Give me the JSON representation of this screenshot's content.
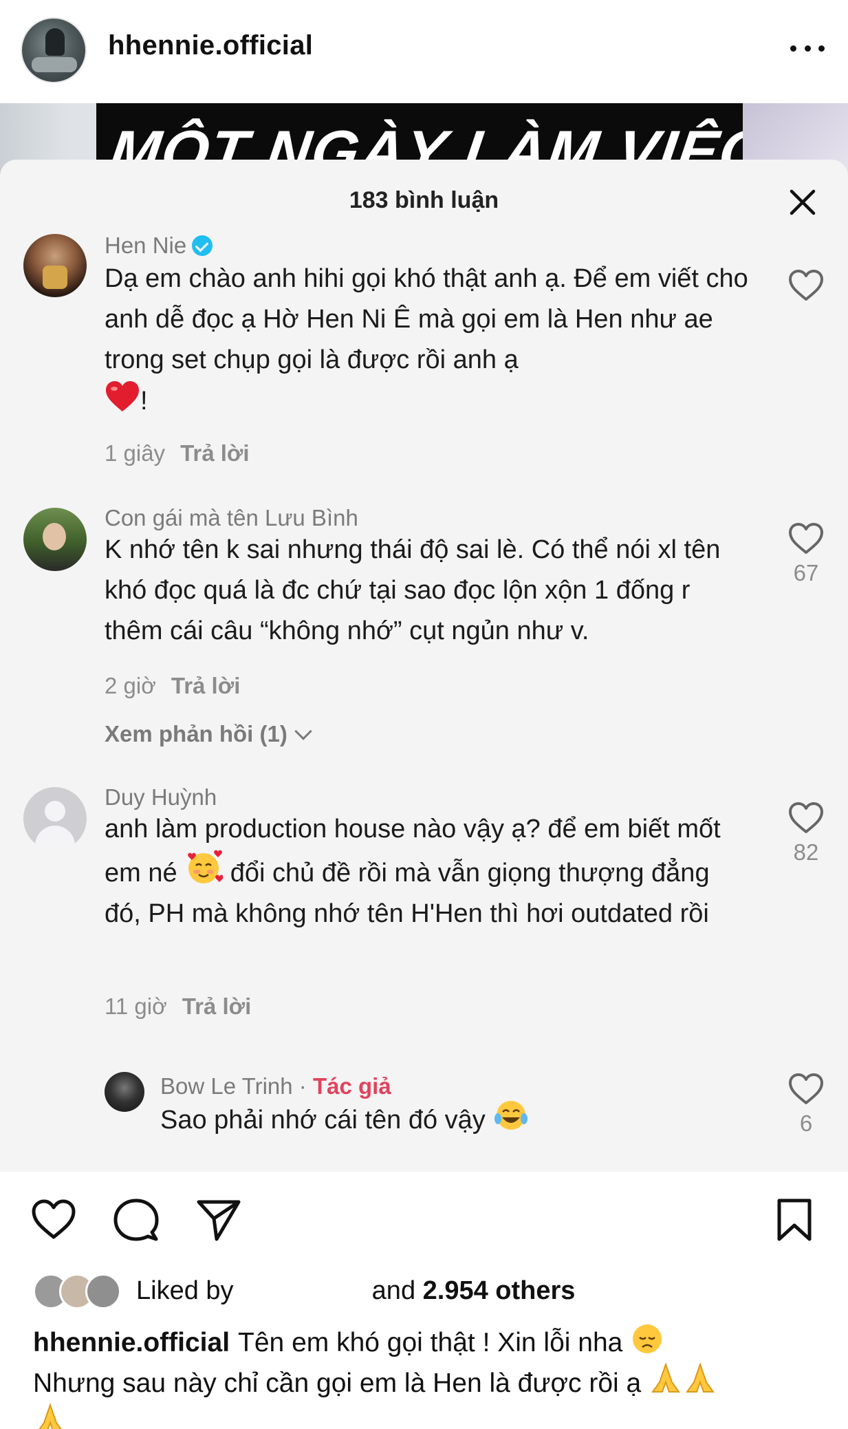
{
  "post": {
    "username": "hhennie.official"
  },
  "video": {
    "headline": "MỘT NGÀY LÀM VIỆC CỦA"
  },
  "sheet": {
    "title": "183 bình luận"
  },
  "comments": [
    {
      "author": "Hen Nie",
      "verified": true,
      "text": "Dạ em chào anh hihi gọi khó thật anh ạ. Để em viết cho anh dễ đọc ạ Hờ Hen Ni Ê mà gọi em là Hen như ae trong set chụp gọi là được rồi anh ạ",
      "text_end": "!",
      "time": "1 giây",
      "reply_label": "Trả lời",
      "likes": ""
    },
    {
      "author": "Con gái mà tên Lưu Bình",
      "text": "K nhớ tên k sai nhưng thái độ sai lè. Có thể nói xl tên khó đọc quá là đc chứ tại sao đọc lộn xộn 1 đống r thêm cái câu “không nhớ” cụt ngủn như v.",
      "time": "2 giờ",
      "reply_label": "Trả lời",
      "likes": "67",
      "view_replies": "Xem phản hồi (1)"
    },
    {
      "author": "Duy Huỳnh",
      "text_before": "anh làm production house nào vậy ạ? để em biết mốt em né",
      "text_after": "đổi chủ đề rồi mà vẫn giọng thượng đẳng đó, PH mà không nhớ tên H'Hen thì hơi outdated rồi",
      "time": "11 giờ",
      "reply_label": "Trả lời",
      "likes": "82"
    },
    {
      "author": "Bow Le Trinh",
      "author_sep": " · ",
      "author_tag": "Tác giả",
      "text": "Sao phải nhớ cái tên đó vậy",
      "likes": "6"
    }
  ],
  "actions": {
    "like": "heart-icon",
    "comment": "comment-icon",
    "share": "share-icon",
    "save": "bookmark-icon"
  },
  "likes_row": {
    "prefix": "Liked by",
    "suffix": "and",
    "others": "2.954 others"
  },
  "caption": {
    "user": "hhennie.official",
    "text1": "Tên em khó gọi thật ! Xin lỗi nha",
    "text2": "Nhưng sau này chỉ cần gọi em là Hen là được rồi ạ"
  },
  "colors": {
    "author_tag": "#e0435d",
    "verified": "#20bdf0",
    "heart_emoji": "#e11d2e"
  }
}
